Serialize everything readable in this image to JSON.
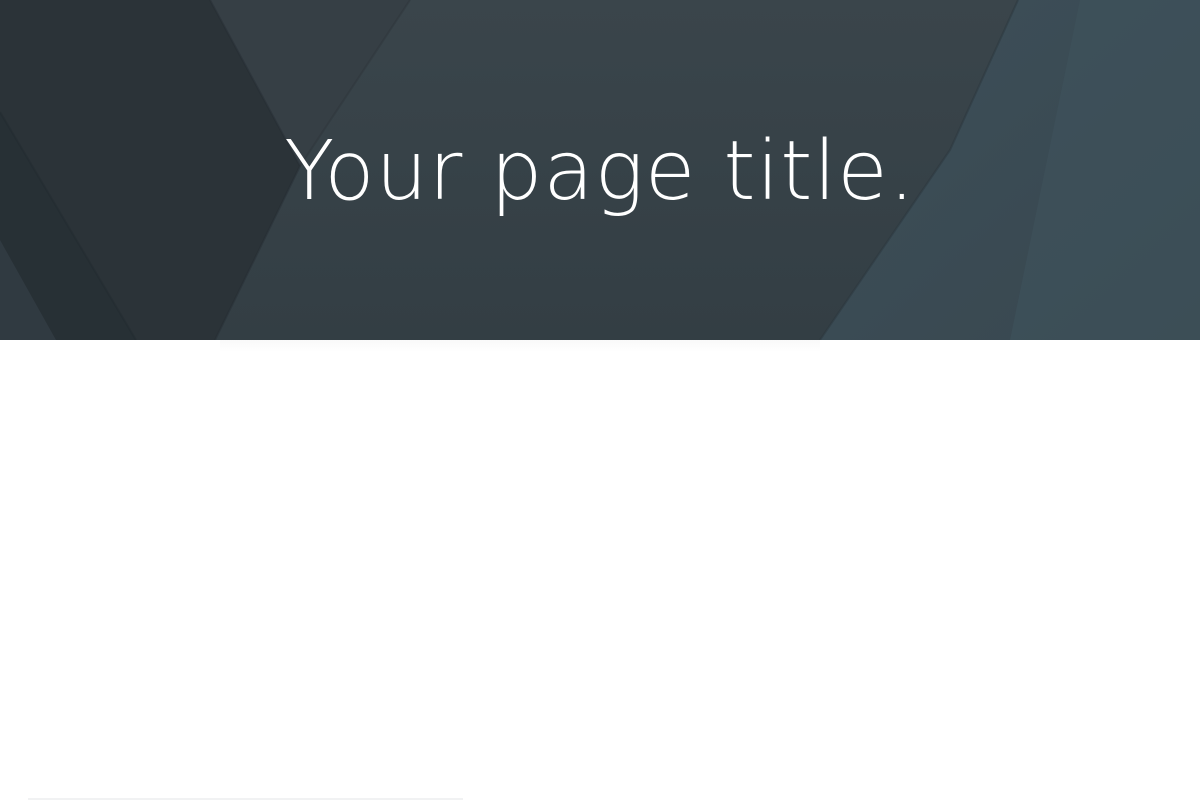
{
  "header": {
    "title": "Your page title."
  },
  "colors": {
    "hero_dark": "#2c3439",
    "hero_mid": "#354047",
    "hero_light": "#3a4c55",
    "title_text": "#ffffff",
    "content_background": "#ffffff"
  }
}
